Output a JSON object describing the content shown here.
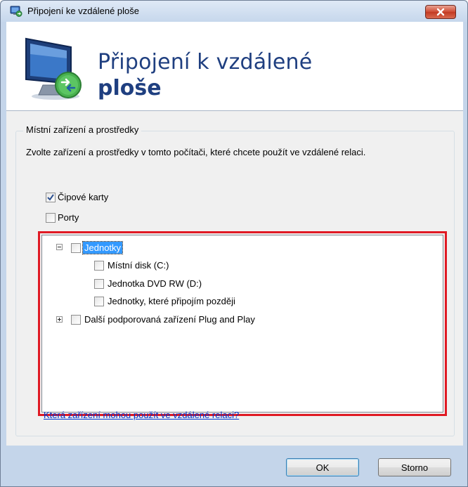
{
  "window": {
    "title": "Připojení ke vzdálené ploše",
    "close_icon": "close-x-icon"
  },
  "header": {
    "line1": "Připojení k vzdálené",
    "line2": "ploše",
    "icon": "remote-desktop-monitor-icon"
  },
  "group": {
    "legend": "Místní zařízení a prostředky",
    "description": "Zvolte zařízení a prostředky v tomto počítači, které chcete použít ve vzdálené relaci."
  },
  "options": [
    {
      "label": "Čipové karty",
      "checked": true
    },
    {
      "label": "Porty",
      "checked": false
    }
  ],
  "tree": {
    "drives": {
      "label": "Jednotky",
      "checked": false,
      "expanded": true,
      "selected": true
    },
    "drive_items": [
      {
        "label": "Místní disk (C:)",
        "checked": false
      },
      {
        "label": "Jednotka DVD RW (D:)",
        "checked": false
      },
      {
        "label": "Jednotky, které připojím později",
        "checked": false
      }
    ],
    "pnp": {
      "label": "Další podporovaná zařízení Plug and Play",
      "checked": false,
      "expanded": false
    }
  },
  "help_link": "Která zařízení mohou použít ve vzdálené relaci?",
  "buttons": {
    "ok": "OK",
    "cancel": "Storno"
  },
  "colors": {
    "highlight_frame": "#e01a24",
    "header_text": "#1f3f80",
    "selection": "#3399ff",
    "link": "#0033cc"
  }
}
